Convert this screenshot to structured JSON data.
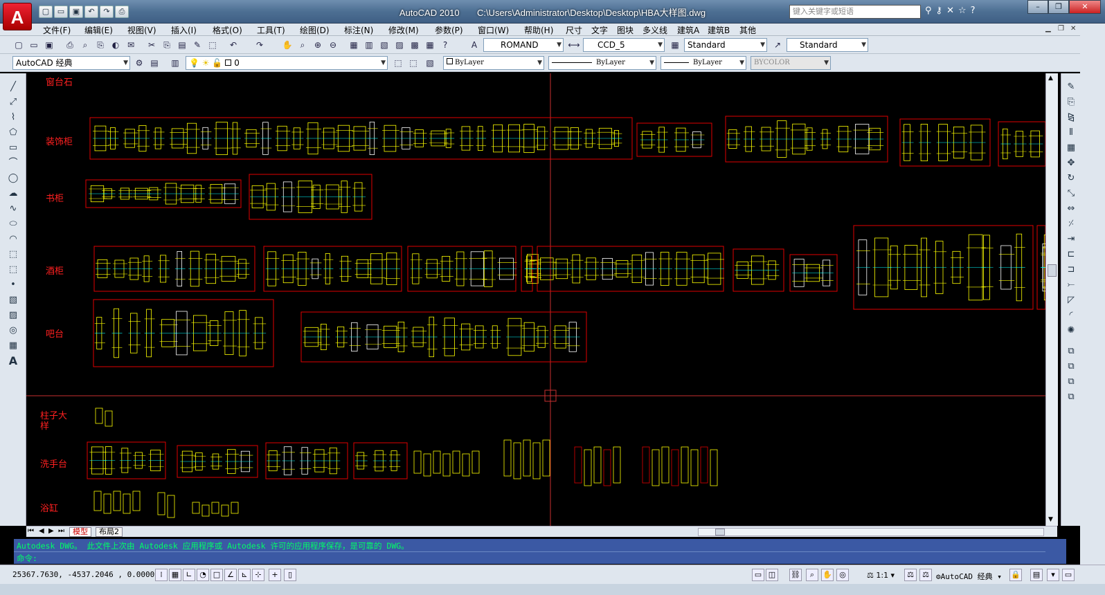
{
  "app": {
    "logo": "A",
    "title": "AutoCAD 2010",
    "file_path": "C:\\Users\\Administrator\\Desktop\\Desktop\\HBA大样图.dwg"
  },
  "search": {
    "placeholder": "键入关键字或短语"
  },
  "window_controls": {
    "minimize": "–",
    "restore": "❐",
    "close": "✕"
  },
  "menu": [
    "文件(F)",
    "编辑(E)",
    "视图(V)",
    "插入(I)",
    "格式(O)",
    "工具(T)",
    "绘图(D)",
    "标注(N)",
    "修改(M)",
    "参数(P)",
    "窗口(W)",
    "帮助(H)",
    "尺寸",
    "文字",
    "图块",
    "多义线",
    "建筑A",
    "建筑B",
    "其他"
  ],
  "toolbar": {
    "text_style": "ROMAND",
    "dim_style": "CCD_5",
    "table_style": "Standard",
    "mleader_style": "Standard",
    "workspace": "AutoCAD 经典",
    "layer": "0",
    "color": "ByLayer",
    "linetype": "ByLayer",
    "lineweight": "ByLayer",
    "plotstyle": "BYCOLOR"
  },
  "categories": [
    "窗台石",
    "装饰柜",
    "书柜",
    "酒柜",
    "吧台",
    "柱子大样",
    "洗手台",
    "浴缸"
  ],
  "tabs": {
    "model": "模型",
    "layout": "布局2"
  },
  "command": {
    "history": "Autodesk DWG。  此文件上次由 Autodesk 应用程序或 Autodesk 许可的应用程序保存，是可靠的 DWG。",
    "prompt": "命令:"
  },
  "status": {
    "coords": "25367.7630, -4537.2046 , 0.0000",
    "scale": "1:1",
    "workspace": "AutoCAD 经典"
  },
  "colors": {
    "background": "#000000",
    "frame": "#e00000",
    "label": "#ff2020",
    "crosshair": "#c83030",
    "drawing": "#ffff00",
    "command_bg": "#3b59a4",
    "command_text": "#00ff66"
  }
}
